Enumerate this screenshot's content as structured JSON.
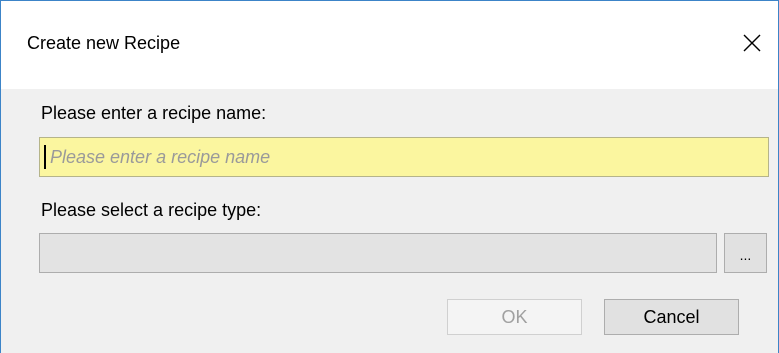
{
  "window": {
    "title": "Create new Recipe",
    "close_icon": "close-icon"
  },
  "form": {
    "name_label": "Please enter a recipe name:",
    "name_value": "",
    "name_placeholder": "Please enter a recipe name",
    "type_label": "Please select a recipe type:",
    "type_value": "",
    "browse_label": "..."
  },
  "buttons": {
    "ok_label": "OK",
    "ok_enabled": false,
    "cancel_label": "Cancel"
  },
  "colors": {
    "name_input_bg": "#fbf69f",
    "content_bg": "#f0f0f0",
    "window_border": "#3c84c8"
  }
}
